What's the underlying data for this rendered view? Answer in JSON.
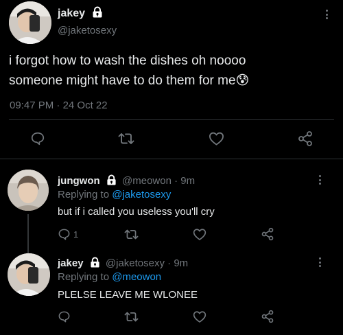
{
  "main_tweet": {
    "display_name": "jakey",
    "handle": "@jaketosexy",
    "text": "i forgot how to wash the dishes oh noooo someone might have to do them for me😰",
    "time": "09:47 PM",
    "separator": "·",
    "date": "24 Oct 22",
    "icons": [
      "reply-icon",
      "retweet-icon",
      "like-icon",
      "share-icon"
    ]
  },
  "reply1": {
    "display_name": "jungwon",
    "handle": "@meowon",
    "separator": "·",
    "age": "9m",
    "replying_prefix": "Replying to",
    "replying_to": "@jaketosexy",
    "text": "but if i called you useless you'll cry",
    "reply_count": "1"
  },
  "reply2": {
    "display_name": "jakey",
    "handle": "@jaketosexy",
    "separator": "·",
    "age": "9m",
    "replying_prefix": "Replying to",
    "replying_to": "@meowon",
    "text": "PLELSE LEAVE ME WLONEE"
  },
  "colors": {
    "background": "#000000",
    "text": "#e7e9ea",
    "muted": "#71767b",
    "link": "#1d9bf0",
    "divider": "#2f3336"
  }
}
